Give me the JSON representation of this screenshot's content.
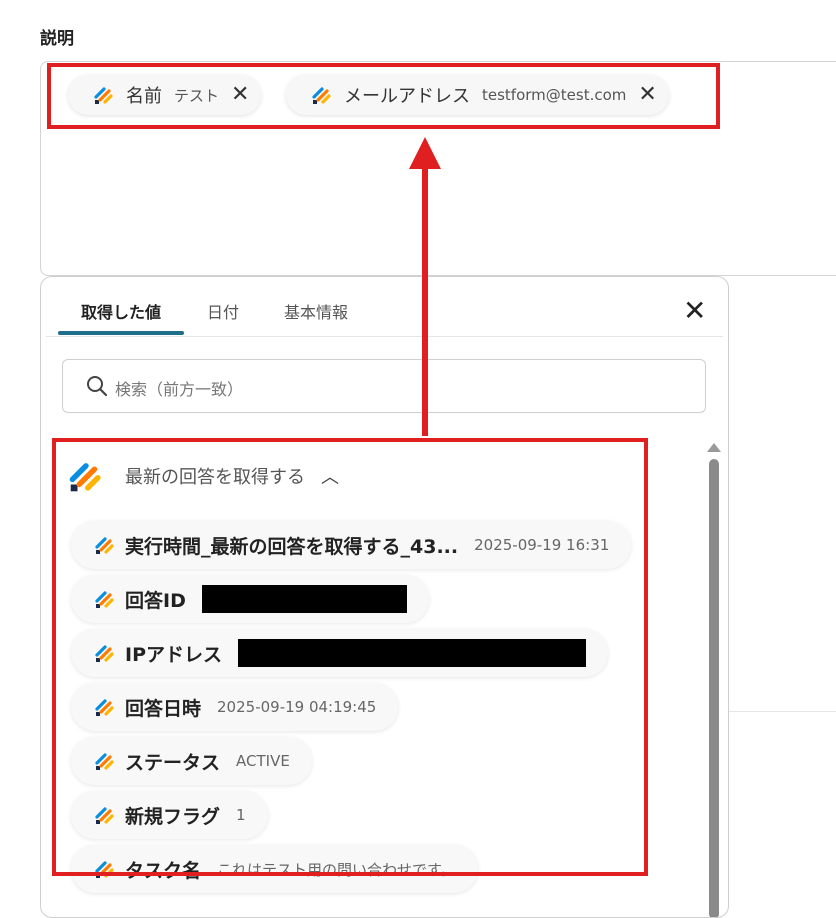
{
  "section": {
    "title": "説明"
  },
  "description_chips": [
    {
      "name": "名前",
      "value": "テスト"
    },
    {
      "name": "メールアドレス",
      "value": "testform@test.com"
    }
  ],
  "tabs": [
    {
      "label": "取得した値",
      "active": true
    },
    {
      "label": "日付",
      "active": false
    },
    {
      "label": "基本情報",
      "active": false
    }
  ],
  "search": {
    "placeholder": "検索（前方一致）"
  },
  "group": {
    "title": "最新の回答を取得する",
    "expanded": true
  },
  "items": [
    {
      "name": "実行時間_最新の回答を取得する_43...",
      "value": "2025-09-19 16:31",
      "redacted": false
    },
    {
      "name": "回答ID",
      "value": "",
      "redacted": true
    },
    {
      "name": "IPアドレス",
      "value": "",
      "redacted": true
    },
    {
      "name": "回答日時",
      "value": "2025-09-19 04:19:45",
      "redacted": false
    },
    {
      "name": "ステータス",
      "value": "ACTIVE",
      "redacted": false
    },
    {
      "name": "新規フラグ",
      "value": "1",
      "redacted": false
    },
    {
      "name": "タスク名",
      "value": "これはテスト用の問い合わせです。",
      "redacted": false
    }
  ],
  "icons": {
    "app": "jotform-app-icon",
    "close": "close-icon",
    "search": "search-icon",
    "collapse": "chevron-up-icon"
  },
  "colors": {
    "highlight": "#e02020",
    "tab_accent": "#1f6f8b"
  }
}
